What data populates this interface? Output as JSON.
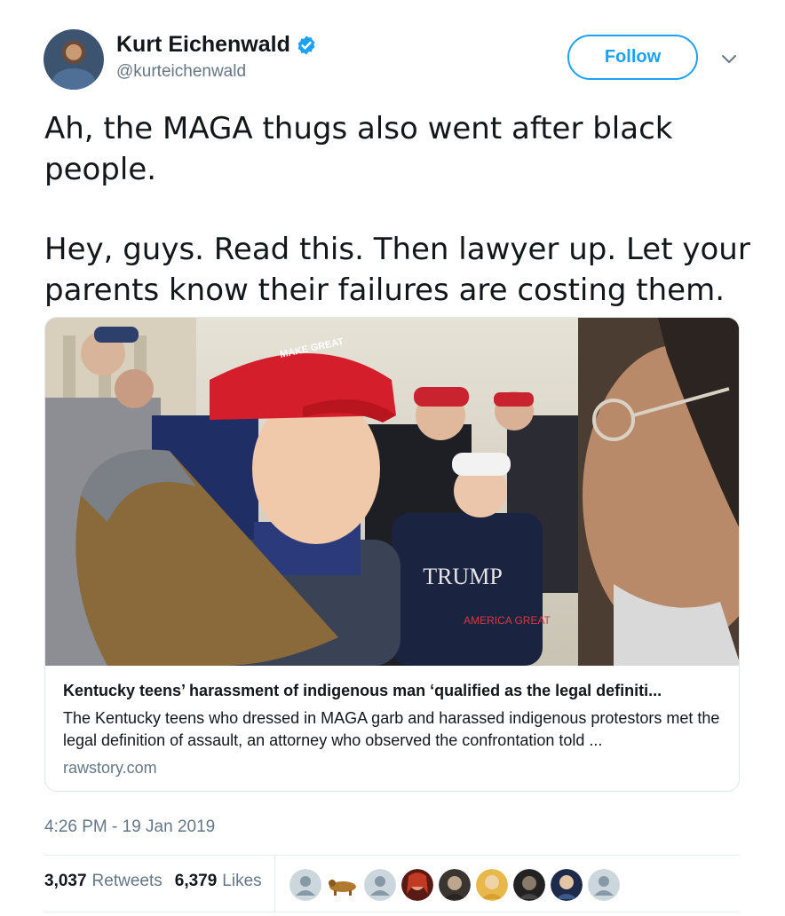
{
  "author": {
    "display_name": "Kurt Eichenwald",
    "handle": "@kurteichenwald",
    "verified": true
  },
  "follow_label": "Follow",
  "tweet": {
    "paragraphs": [
      "Ah, the MAGA thugs also went after black people.",
      "Hey, guys. Read this. Then lawyer up. Let your parents know their failures are costing them."
    ]
  },
  "card": {
    "title": "Kentucky teens’ harassment of indigenous man ‘qualified as the legal definiti...",
    "description": "The Kentucky teens who dressed in MAGA garb and harassed indigenous protestors met the legal definition of assault, an attorney who observed the confrontation told ...",
    "domain": "rawstory.com",
    "image_text": {
      "hat": "MAKE GREAT",
      "hoodie_top": "TRUMP",
      "hoodie_bottom": "AMERICA GREAT"
    }
  },
  "timestamp": "4:26 PM - 19 Jan 2019",
  "stats": {
    "retweets_count": "3,037",
    "retweets_label": "Retweets",
    "likes_count": "6,379",
    "likes_label": "Likes"
  },
  "likers": [
    {
      "icon": "default-avatar-icon"
    },
    {
      "icon": "dog-avatar-icon"
    },
    {
      "icon": "default-avatar-icon"
    },
    {
      "icon": "person-avatar-icon"
    },
    {
      "icon": "person-avatar-icon"
    },
    {
      "icon": "person-avatar-icon"
    },
    {
      "icon": "person-avatar-icon"
    },
    {
      "icon": "person-avatar-icon"
    },
    {
      "icon": "default-avatar-icon"
    }
  ],
  "colors": {
    "accent": "#1da1f2",
    "secondary_text": "#657786",
    "primary_text": "#14171a"
  }
}
